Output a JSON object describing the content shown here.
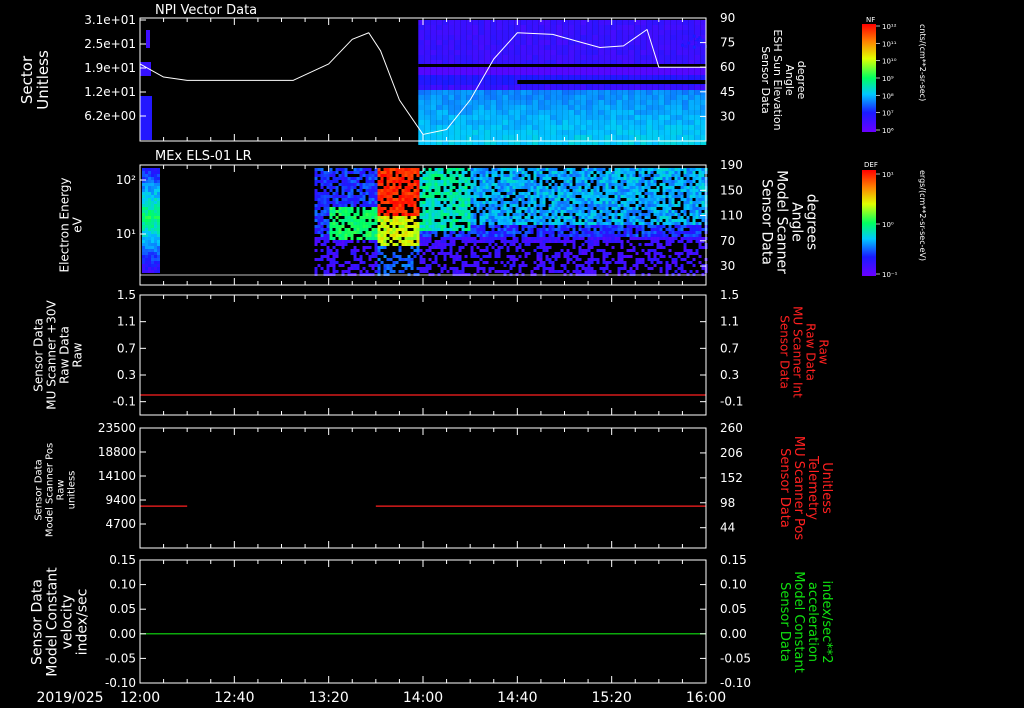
{
  "colors": {
    "background": "#000000",
    "foreground": "#ffffff",
    "trace_red": "#ff2020",
    "trace_green": "#10e010",
    "label_red": "#ff2020",
    "label_green": "#10e010"
  },
  "time_axis": {
    "date_label": "2019/025",
    "tick_labels": [
      "12:00",
      "12:40",
      "13:20",
      "14:00",
      "14:40",
      "15:20",
      "16:00"
    ],
    "range_minutes": [
      0,
      240
    ]
  },
  "colorbars": [
    {
      "tag": "NF",
      "unit": "cnts/(cm**2-sr-sec)",
      "tick_labels": [
        "10¹²",
        "10¹¹",
        "10¹⁰",
        "10⁹",
        "10⁸",
        "10⁷",
        "10⁶"
      ]
    },
    {
      "tag": "DEF",
      "unit": "ergs/(cm**2-sr-sec-eV)",
      "tick_labels": [
        "10¹",
        "10⁰",
        "10⁻¹"
      ]
    }
  ],
  "chart_data": [
    {
      "type": "heatmap",
      "title": "NPI Vector Data",
      "ylabel_lines": [
        "Sector",
        "Unitless"
      ],
      "y_tick_labels": [
        "3.1e+01",
        "2.5e+01",
        "1.9e+01",
        "1.2e+01",
        "6.2e+00"
      ],
      "ylim": [
        0,
        32
      ],
      "right_ylabel_lines": [
        "Sensor Data",
        "ESH Sun Elevation",
        "Angle",
        "degree"
      ],
      "right_y_tick_labels": [
        "90",
        "75",
        "60",
        "45",
        "30"
      ],
      "right_ylim": [
        15,
        90
      ],
      "colorbar": "NF",
      "overlay_series": {
        "name": "ESH Sun Elevation Angle",
        "x_minutes": [
          0,
          10,
          20,
          50,
          65,
          80,
          90,
          97,
          102,
          110,
          120,
          130,
          140,
          150,
          160,
          175,
          185,
          195,
          205,
          210,
          215,
          220,
          232,
          240
        ],
        "y": [
          62,
          54,
          52,
          52,
          52,
          62,
          77,
          81,
          70,
          40,
          19,
          22,
          40,
          65,
          81,
          80,
          76,
          72,
          73,
          78,
          83,
          60,
          60,
          60
        ]
      }
    },
    {
      "type": "heatmap",
      "title": "MEx ELS-01 LR",
      "ylabel_lines": [
        "Electron Energy",
        "eV"
      ],
      "y_tick_labels": [
        "10²",
        "10¹"
      ],
      "ylim_log": [
        0.2,
        2.3
      ],
      "right_ylabel_lines": [
        "Sensor Data",
        "Model Scanner",
        "Angle",
        "degrees"
      ],
      "right_y_tick_labels": [
        "190",
        "150",
        "110",
        "70",
        "30"
      ],
      "right_ylim": [
        0,
        190
      ],
      "colorbar": "DEF"
    },
    {
      "type": "line",
      "title": "",
      "ylabel_lines": [
        "Sensor Data",
        "MU Scanner +30V",
        "Raw Data",
        "Raw"
      ],
      "y_tick_labels": [
        "1.5",
        "1.1",
        "0.7",
        "0.3",
        "-0.1"
      ],
      "ylim": [
        -0.3,
        1.5
      ],
      "right_ylabel_lines": [
        "Sensor Data",
        "MU Scanner Int",
        "Raw Data",
        "Raw"
      ],
      "right_y_tick_labels": [
        "1.5",
        "1.1",
        "0.7",
        "0.3",
        "-0.1"
      ],
      "right_ylim": [
        -0.3,
        1.5
      ],
      "series": [
        {
          "x_minutes": [
            0,
            240
          ],
          "y": [
            0.0,
            0.0
          ],
          "color": "red"
        }
      ]
    },
    {
      "type": "line",
      "title": "",
      "ylabel_lines": [
        "Sensor Data",
        "Model Scanner Pos",
        "Raw",
        "unitless"
      ],
      "y_tick_labels": [
        "23500",
        "18800",
        "14100",
        "9400",
        "4700"
      ],
      "ylim": [
        0,
        23500
      ],
      "right_ylabel_lines": [
        "Sensor Data",
        "MU Scanner Pos",
        "Telemetry",
        "Unitless"
      ],
      "right_y_tick_labels": [
        "260",
        "206",
        "152",
        "98",
        "44"
      ],
      "right_ylim": [
        0,
        260
      ],
      "series": [
        {
          "x_minutes": [
            0,
            20
          ],
          "y": [
            8200,
            8200
          ],
          "color": "red"
        },
        {
          "x_minutes": [
            100,
            240
          ],
          "y": [
            8200,
            8200
          ],
          "color": "red"
        }
      ]
    },
    {
      "type": "line",
      "title": "",
      "ylabel_lines": [
        "Sensor Data",
        "Model Constant",
        "velocity",
        "index/sec"
      ],
      "y_tick_labels": [
        "0.15",
        "0.10",
        "0.05",
        "0.00",
        "-0.05",
        "-0.10"
      ],
      "ylim": [
        -0.1,
        0.15
      ],
      "right_ylabel_lines": [
        "Sensor Data",
        "Model Constant",
        "acceleration",
        "index/sec**2"
      ],
      "right_y_tick_labels": [
        "0.15",
        "0.10",
        "0.05",
        "0.00",
        "-0.05",
        "-0.10"
      ],
      "right_ylim": [
        -0.1,
        0.15
      ],
      "series": [
        {
          "x_minutes": [
            0,
            240
          ],
          "y": [
            0.0,
            0.0
          ],
          "color": "green"
        }
      ]
    }
  ]
}
